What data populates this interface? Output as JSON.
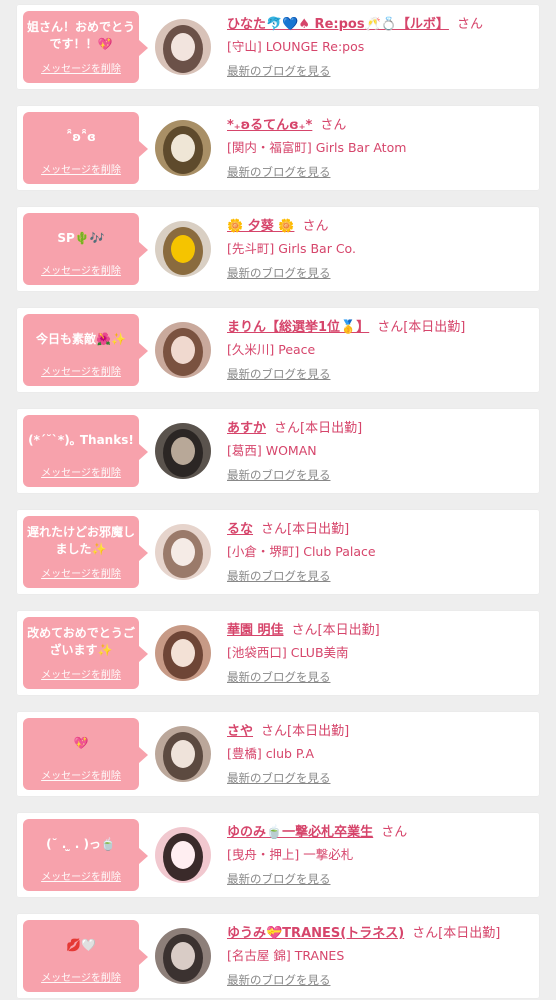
{
  "accent_pink": "#f7a2ac",
  "name_color": "#d6456b",
  "messages": [
    {
      "text": "姐さん！おめでとうです！！💖",
      "delete_label": "メッセージを削除",
      "name": "ひなた🐬💙♠ Re:pos🥂💍【ルボ】",
      "san": "さん",
      "shop": "[守山] LOUNGE Re:pos",
      "blog_label": "最新のブログを見る",
      "avatar_colors": [
        "#d8c2b8",
        "#f2e4de",
        "#6b5148"
      ]
    },
    {
      "text": "ˆ̑̑ʚˆ̑̑ɞ",
      "delete_label": "メッセージを削除",
      "name": "*₊ʚるてんɞ₊*",
      "san": "さん",
      "shop": "[関内・福富町] Girls Bar Atom",
      "blog_label": "最新のブログを見る",
      "avatar_colors": [
        "#a88f66",
        "#efe6d6",
        "#5e4a2c"
      ]
    },
    {
      "text": "SP🌵🎶",
      "delete_label": "メッセージを削除",
      "name": "🌼 夕葵 🌼",
      "san": "さん",
      "shop": "[先斗町] Girls Bar Co.",
      "blog_label": "最新のブログを見る",
      "avatar_colors": [
        "#d9cfc3",
        "#f5c400",
        "#8a6b3e"
      ]
    },
    {
      "text": "今日も素敵🌺✨",
      "delete_label": "メッセージを削除",
      "name": "まりん【総選挙1位🥇】",
      "san": "さん[本日出勤]",
      "shop": "[久米川] Peace",
      "blog_label": "最新のブログを見る",
      "avatar_colors": [
        "#c9a99c",
        "#f0d9cf",
        "#7a5240"
      ]
    },
    {
      "text": "(*ˊ˘ˋ*)｡ Thanks!",
      "delete_label": "メッセージを削除",
      "name": "あすか",
      "san": "さん[本日出勤]",
      "shop": "[葛西] WOMAN",
      "blog_label": "最新のブログを見る",
      "avatar_colors": [
        "#5a534d",
        "#b8a898",
        "#2b2624"
      ]
    },
    {
      "text": "遅れたけどお邪魔しました✨",
      "delete_label": "メッセージを削除",
      "name": "るな",
      "san": "さん[本日出勤]",
      "shop": "[小倉・堺町] Club Palace",
      "blog_label": "最新のブログを見る",
      "avatar_colors": [
        "#e6d4cc",
        "#f5ebe6",
        "#9a7a6a"
      ]
    },
    {
      "text": "改めておめでとうございます✨",
      "delete_label": "メッセージを削除",
      "name": "華園 明佳",
      "san": "さん[本日出勤]",
      "shop": "[池袋西口] CLUB美南",
      "blog_label": "最新のブログを見る",
      "avatar_colors": [
        "#c79a86",
        "#f3e1d6",
        "#6e4536"
      ]
    },
    {
      "text": "💖",
      "delete_label": "メッセージを削除",
      "name": "さや",
      "san": "さん[本日出勤]",
      "shop": "[豊橋] club P.A",
      "blog_label": "最新のブログを見る",
      "avatar_colors": [
        "#bba79a",
        "#efe3da",
        "#5c4a40"
      ]
    },
    {
      "text": "(˘ . ̫ . )っ🍵",
      "delete_label": "メッセージを削除",
      "name": "ゆのみ🍵一撃必札卒業生",
      "san": "さん",
      "shop": "[曳舟・押上] 一撃必札",
      "blog_label": "最新のブログを見る",
      "avatar_colors": [
        "#f1c8cf",
        "#ffeef1",
        "#3a2a2a"
      ]
    },
    {
      "text": "💋🤍",
      "delete_label": "メッセージを削除",
      "name": "ゆうみ💝TRANES(トラネス)",
      "san": "さん[本日出勤]",
      "shop": "[名古屋 錦] TRANES",
      "blog_label": "最新のブログを見る",
      "avatar_colors": [
        "#8d7f79",
        "#d9ccc6",
        "#3b3230"
      ]
    }
  ]
}
